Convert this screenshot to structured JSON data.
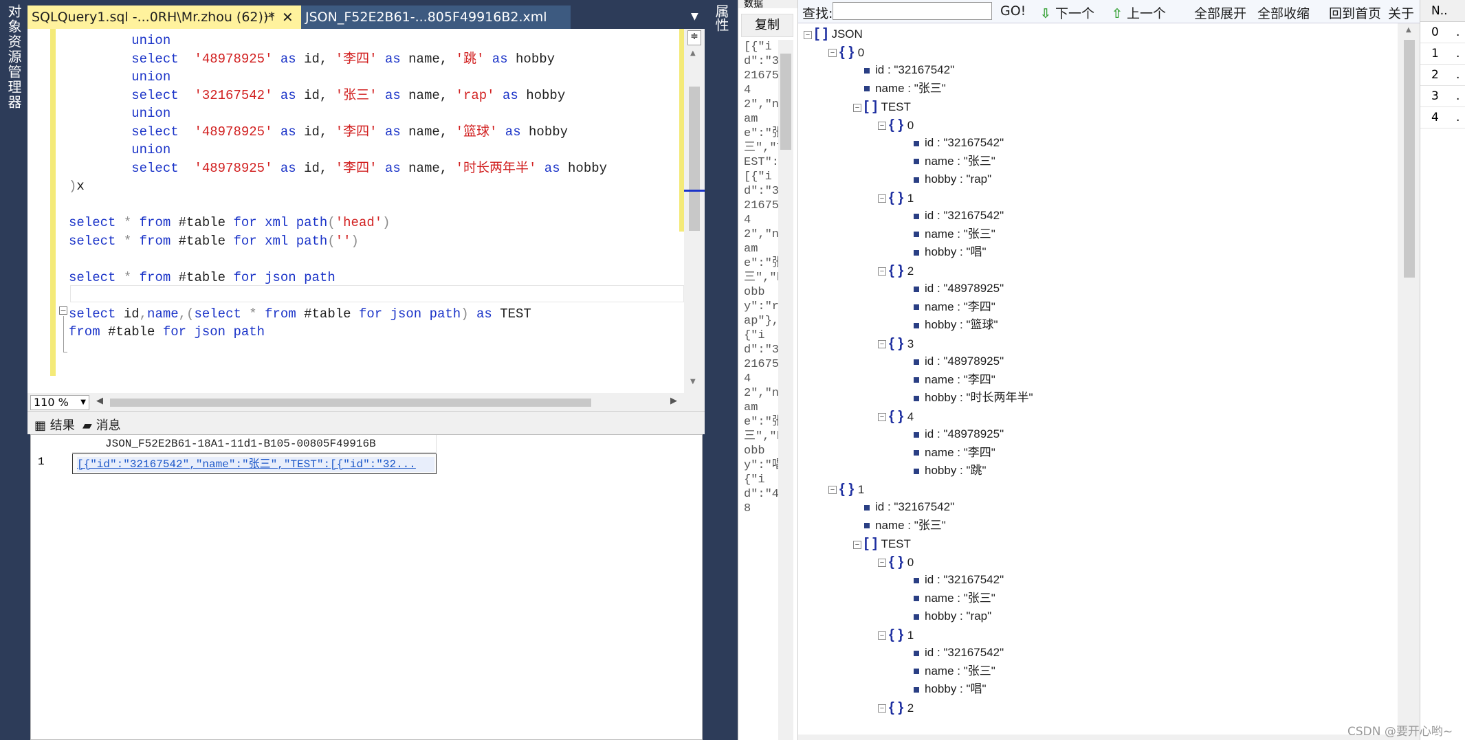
{
  "left_panel": {
    "label": "对象资源管理器"
  },
  "tabs": [
    {
      "label": "SQLQuery1.sql -...0RH\\Mr.zhou (62))*",
      "pin": "⊣",
      "close": "✕"
    },
    {
      "label": "JSON_F52E2B61-...805F49916B2.xml"
    }
  ],
  "tab_dropdown": "▼",
  "editor": {
    "lines": [
      [
        {
          "t": "        ",
          "c": "pl"
        },
        {
          "t": "union",
          "c": "kw"
        }
      ],
      [
        {
          "t": "        ",
          "c": "pl"
        },
        {
          "t": "select",
          "c": "kw"
        },
        {
          "t": "  ",
          "c": "pl"
        },
        {
          "t": "'48978925'",
          "c": "str"
        },
        {
          "t": " ",
          "c": "pl"
        },
        {
          "t": "as",
          "c": "kw"
        },
        {
          "t": " id, ",
          "c": "pl"
        },
        {
          "t": "'李四'",
          "c": "str"
        },
        {
          "t": " ",
          "c": "pl"
        },
        {
          "t": "as",
          "c": "kw"
        },
        {
          "t": " name, ",
          "c": "pl"
        },
        {
          "t": "'跳'",
          "c": "str"
        },
        {
          "t": " ",
          "c": "pl"
        },
        {
          "t": "as",
          "c": "kw"
        },
        {
          "t": " hobby",
          "c": "pl"
        }
      ],
      [
        {
          "t": "        ",
          "c": "pl"
        },
        {
          "t": "union",
          "c": "kw"
        }
      ],
      [
        {
          "t": "        ",
          "c": "pl"
        },
        {
          "t": "select",
          "c": "kw"
        },
        {
          "t": "  ",
          "c": "pl"
        },
        {
          "t": "'32167542'",
          "c": "str"
        },
        {
          "t": " ",
          "c": "pl"
        },
        {
          "t": "as",
          "c": "kw"
        },
        {
          "t": " id, ",
          "c": "pl"
        },
        {
          "t": "'张三'",
          "c": "str"
        },
        {
          "t": " ",
          "c": "pl"
        },
        {
          "t": "as",
          "c": "kw"
        },
        {
          "t": " name, ",
          "c": "pl"
        },
        {
          "t": "'rap'",
          "c": "str"
        },
        {
          "t": " ",
          "c": "pl"
        },
        {
          "t": "as",
          "c": "kw"
        },
        {
          "t": " hobby",
          "c": "pl"
        }
      ],
      [
        {
          "t": "        ",
          "c": "pl"
        },
        {
          "t": "union",
          "c": "kw"
        }
      ],
      [
        {
          "t": "        ",
          "c": "pl"
        },
        {
          "t": "select",
          "c": "kw"
        },
        {
          "t": "  ",
          "c": "pl"
        },
        {
          "t": "'48978925'",
          "c": "str"
        },
        {
          "t": " ",
          "c": "pl"
        },
        {
          "t": "as",
          "c": "kw"
        },
        {
          "t": " id, ",
          "c": "pl"
        },
        {
          "t": "'李四'",
          "c": "str"
        },
        {
          "t": " ",
          "c": "pl"
        },
        {
          "t": "as",
          "c": "kw"
        },
        {
          "t": " name, ",
          "c": "pl"
        },
        {
          "t": "'篮球'",
          "c": "str"
        },
        {
          "t": " ",
          "c": "pl"
        },
        {
          "t": "as",
          "c": "kw"
        },
        {
          "t": " hobby",
          "c": "pl"
        }
      ],
      [
        {
          "t": "        ",
          "c": "pl"
        },
        {
          "t": "union",
          "c": "kw"
        }
      ],
      [
        {
          "t": "        ",
          "c": "pl"
        },
        {
          "t": "select",
          "c": "kw"
        },
        {
          "t": "  ",
          "c": "pl"
        },
        {
          "t": "'48978925'",
          "c": "str"
        },
        {
          "t": " ",
          "c": "pl"
        },
        {
          "t": "as",
          "c": "kw"
        },
        {
          "t": " id, ",
          "c": "pl"
        },
        {
          "t": "'李四'",
          "c": "str"
        },
        {
          "t": " ",
          "c": "pl"
        },
        {
          "t": "as",
          "c": "kw"
        },
        {
          "t": " name, ",
          "c": "pl"
        },
        {
          "t": "'时长两年半'",
          "c": "str"
        },
        {
          "t": " ",
          "c": "pl"
        },
        {
          "t": "as",
          "c": "kw"
        },
        {
          "t": " hobby",
          "c": "pl"
        }
      ],
      [
        {
          "t": ")",
          "c": "gr"
        },
        {
          "t": "x",
          "c": "pl"
        }
      ],
      [],
      [
        {
          "t": "select",
          "c": "kw"
        },
        {
          "t": " ",
          "c": "pl"
        },
        {
          "t": "*",
          "c": "gr"
        },
        {
          "t": " ",
          "c": "pl"
        },
        {
          "t": "from",
          "c": "kw"
        },
        {
          "t": " #table ",
          "c": "pl"
        },
        {
          "t": "for",
          "c": "kw"
        },
        {
          "t": " ",
          "c": "pl"
        },
        {
          "t": "xml",
          "c": "kw"
        },
        {
          "t": " ",
          "c": "pl"
        },
        {
          "t": "path",
          "c": "kw"
        },
        {
          "t": "(",
          "c": "gr"
        },
        {
          "t": "'head'",
          "c": "str"
        },
        {
          "t": ")",
          "c": "gr"
        }
      ],
      [
        {
          "t": "select",
          "c": "kw"
        },
        {
          "t": " ",
          "c": "pl"
        },
        {
          "t": "*",
          "c": "gr"
        },
        {
          "t": " ",
          "c": "pl"
        },
        {
          "t": "from",
          "c": "kw"
        },
        {
          "t": " #table ",
          "c": "pl"
        },
        {
          "t": "for",
          "c": "kw"
        },
        {
          "t": " ",
          "c": "pl"
        },
        {
          "t": "xml",
          "c": "kw"
        },
        {
          "t": " ",
          "c": "pl"
        },
        {
          "t": "path",
          "c": "kw"
        },
        {
          "t": "(",
          "c": "gr"
        },
        {
          "t": "''",
          "c": "str"
        },
        {
          "t": ")",
          "c": "gr"
        }
      ],
      [],
      [
        {
          "t": "select",
          "c": "kw"
        },
        {
          "t": " ",
          "c": "pl"
        },
        {
          "t": "*",
          "c": "gr"
        },
        {
          "t": " ",
          "c": "pl"
        },
        {
          "t": "from",
          "c": "kw"
        },
        {
          "t": " #table ",
          "c": "pl"
        },
        {
          "t": "for",
          "c": "kw"
        },
        {
          "t": " ",
          "c": "pl"
        },
        {
          "t": "json",
          "c": "kw"
        },
        {
          "t": " ",
          "c": "pl"
        },
        {
          "t": "path",
          "c": "kw"
        }
      ],
      [],
      [
        {
          "t": "select",
          "c": "kw"
        },
        {
          "t": " id",
          "c": "pl"
        },
        {
          "t": ",",
          "c": "gr"
        },
        {
          "t": "name",
          "c": "kw"
        },
        {
          "t": ",(",
          "c": "gr"
        },
        {
          "t": "select",
          "c": "kw"
        },
        {
          "t": " ",
          "c": "pl"
        },
        {
          "t": "*",
          "c": "gr"
        },
        {
          "t": " ",
          "c": "pl"
        },
        {
          "t": "from",
          "c": "kw"
        },
        {
          "t": " #table ",
          "c": "pl"
        },
        {
          "t": "for",
          "c": "kw"
        },
        {
          "t": " ",
          "c": "pl"
        },
        {
          "t": "json",
          "c": "kw"
        },
        {
          "t": " ",
          "c": "pl"
        },
        {
          "t": "path",
          "c": "kw"
        },
        {
          "t": ")",
          "c": "gr"
        },
        {
          "t": " ",
          "c": "pl"
        },
        {
          "t": "as",
          "c": "kw"
        },
        {
          "t": " TEST",
          "c": "pl"
        }
      ],
      [
        {
          "t": "from",
          "c": "kw"
        },
        {
          "t": " #table ",
          "c": "pl"
        },
        {
          "t": "for",
          "c": "kw"
        },
        {
          "t": " ",
          "c": "pl"
        },
        {
          "t": "json",
          "c": "kw"
        },
        {
          "t": " ",
          "c": "pl"
        },
        {
          "t": "path",
          "c": "kw"
        }
      ]
    ]
  },
  "zoom": {
    "value": "110 %"
  },
  "results_tabs": {
    "results": "结果",
    "messages": "消息"
  },
  "grid": {
    "column_header": "JSON_F52E2B61-18A1-11d1-B105-00805F49916B",
    "row_number": "1",
    "cell_value": "[{\"id\":\"32167542\",\"name\":\"张三\",\"TEST\":[{\"id\":\"32..."
  },
  "properties_strip": {
    "label": "属性"
  },
  "copy_panel": {
    "top_label": "数据",
    "copy_button": "复制",
    "text": "[{\"id\":\"32167542\",\"name\":\"张三\",\"TEST\":[{\"id\":\"32167542\",\"name\":\"张三\",\"hobby\":\"rap\"},{\"id\":\"32167542\",\"name\":\"张三\",\"hobby\":\"唱\"},{\"id\":\"48"
  },
  "json_viewer": {
    "find_label": "查找:",
    "go_label": "GO!",
    "next_label": "下一个",
    "prev_label": "上一个",
    "expand_all": "全部展开",
    "collapse_all": "全部收缩",
    "home": "回到首页",
    "about": "关于",
    "tree": [
      {
        "d": 0,
        "type": "arr",
        "label": "JSON"
      },
      {
        "d": 1,
        "type": "obj",
        "label": "0"
      },
      {
        "d": 2,
        "type": "leaf",
        "label": "id : \"32167542\""
      },
      {
        "d": 2,
        "type": "leaf",
        "label": "name : \"张三\""
      },
      {
        "d": 2,
        "type": "arr",
        "label": "TEST"
      },
      {
        "d": 3,
        "type": "obj",
        "label": "0"
      },
      {
        "d": 4,
        "type": "leaf",
        "label": "id : \"32167542\""
      },
      {
        "d": 4,
        "type": "leaf",
        "label": "name : \"张三\""
      },
      {
        "d": 4,
        "type": "leaf",
        "label": "hobby : \"rap\""
      },
      {
        "d": 3,
        "type": "obj",
        "label": "1"
      },
      {
        "d": 4,
        "type": "leaf",
        "label": "id : \"32167542\""
      },
      {
        "d": 4,
        "type": "leaf",
        "label": "name : \"张三\""
      },
      {
        "d": 4,
        "type": "leaf",
        "label": "hobby : \"唱\""
      },
      {
        "d": 3,
        "type": "obj",
        "label": "2"
      },
      {
        "d": 4,
        "type": "leaf",
        "label": "id : \"48978925\""
      },
      {
        "d": 4,
        "type": "leaf",
        "label": "name : \"李四\""
      },
      {
        "d": 4,
        "type": "leaf",
        "label": "hobby : \"篮球\""
      },
      {
        "d": 3,
        "type": "obj",
        "label": "3"
      },
      {
        "d": 4,
        "type": "leaf",
        "label": "id : \"48978925\""
      },
      {
        "d": 4,
        "type": "leaf",
        "label": "name : \"李四\""
      },
      {
        "d": 4,
        "type": "leaf",
        "label": "hobby : \"时长两年半\""
      },
      {
        "d": 3,
        "type": "obj",
        "label": "4"
      },
      {
        "d": 4,
        "type": "leaf",
        "label": "id : \"48978925\""
      },
      {
        "d": 4,
        "type": "leaf",
        "label": "name : \"李四\""
      },
      {
        "d": 4,
        "type": "leaf",
        "label": "hobby : \"跳\""
      },
      {
        "d": 1,
        "type": "obj",
        "label": "1"
      },
      {
        "d": 2,
        "type": "leaf",
        "label": "id : \"32167542\""
      },
      {
        "d": 2,
        "type": "leaf",
        "label": "name : \"张三\""
      },
      {
        "d": 2,
        "type": "arr",
        "label": "TEST"
      },
      {
        "d": 3,
        "type": "obj",
        "label": "0"
      },
      {
        "d": 4,
        "type": "leaf",
        "label": "id : \"32167542\""
      },
      {
        "d": 4,
        "type": "leaf",
        "label": "name : \"张三\""
      },
      {
        "d": 4,
        "type": "leaf",
        "label": "hobby : \"rap\""
      },
      {
        "d": 3,
        "type": "obj",
        "label": "1"
      },
      {
        "d": 4,
        "type": "leaf",
        "label": "id : \"32167542\""
      },
      {
        "d": 4,
        "type": "leaf",
        "label": "name : \"张三\""
      },
      {
        "d": 4,
        "type": "leaf",
        "label": "hobby : \"唱\""
      },
      {
        "d": 3,
        "type": "obj",
        "label": "2"
      }
    ]
  },
  "right_panel": {
    "header": "N..",
    "rows": [
      "0",
      "1",
      "2",
      "3",
      "4"
    ]
  },
  "watermark": "CSDN @要开心哟~",
  "colors": {
    "accent_tab": "#fff29d",
    "keyword": "#1a33c8",
    "string": "#d11f1f",
    "chrome": "#2d3c59"
  }
}
